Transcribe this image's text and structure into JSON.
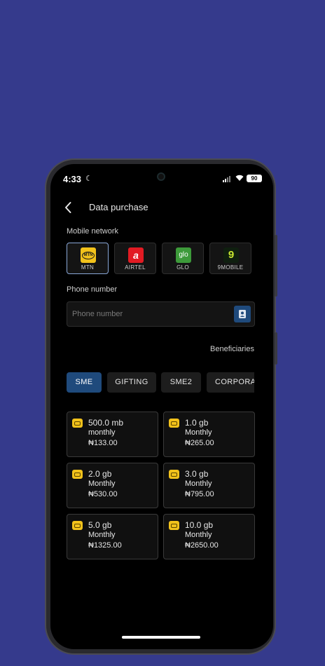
{
  "status_bar": {
    "time": "4:33",
    "battery": "90"
  },
  "header": {
    "title": "Data purchase"
  },
  "network": {
    "label": "Mobile network",
    "options": [
      {
        "name": "MTN",
        "logo_text": "MTN",
        "color": "#f2c21b",
        "selected": true
      },
      {
        "name": "AIRTEL",
        "logo_text": "a",
        "color": "#e21b23",
        "selected": false
      },
      {
        "name": "GLO",
        "logo_text": "glo",
        "color": "#3d9a3a",
        "selected": false
      },
      {
        "name": "9MOBILE",
        "logo_text": "9",
        "color": "#0f1f0f",
        "selected": false
      }
    ]
  },
  "phone": {
    "label": "Phone number",
    "placeholder": "Phone number",
    "value": ""
  },
  "beneficiaries_label": "Beneficiaries",
  "tabs": [
    {
      "label": "SME",
      "active": true
    },
    {
      "label": "GIFTING",
      "active": false
    },
    {
      "label": "SME2",
      "active": false
    },
    {
      "label": "CORPORATE",
      "active": false
    }
  ],
  "plans": [
    {
      "size": "500.0 mb",
      "period": "monthly",
      "price": "₦133.00"
    },
    {
      "size": "1.0 gb",
      "period": "Monthly",
      "price": "₦265.00"
    },
    {
      "size": "2.0 gb",
      "period": "Monthly",
      "price": "₦530.00"
    },
    {
      "size": "3.0 gb",
      "period": "Monthly",
      "price": "₦795.00"
    },
    {
      "size": "5.0 gb",
      "period": "Monthly",
      "price": "₦1325.00"
    },
    {
      "size": "10.0 gb",
      "period": "Monthly",
      "price": "₦2650.00"
    }
  ],
  "colors": {
    "accent": "#1f4a7c",
    "background": "#353a8c",
    "sim_icon": "#f2c21b"
  }
}
